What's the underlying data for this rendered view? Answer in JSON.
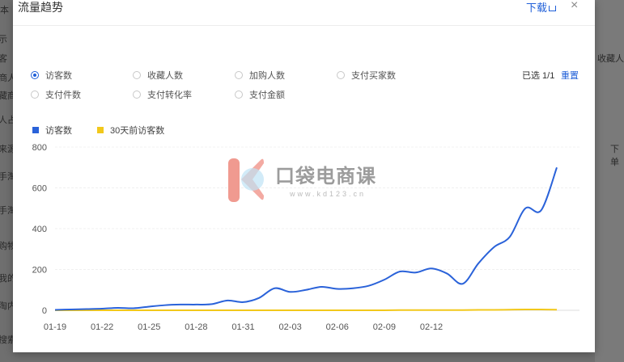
{
  "background": {
    "left_fragments": [
      "本",
      "示",
      "客",
      "商人",
      "藏商",
      "人占",
      "来源",
      "手淘",
      "手淘",
      "购物",
      "我的",
      "淘内",
      "搜索"
    ],
    "right_fragments": [
      "收藏人",
      "下单"
    ]
  },
  "modal": {
    "title": "流量趋势",
    "download_label": "下载",
    "close_symbol": "×",
    "selected_info": "已选 1/1",
    "reset_label": "重置"
  },
  "metrics": [
    {
      "label": "访客数",
      "checked": true
    },
    {
      "label": "收藏人数",
      "checked": false
    },
    {
      "label": "加购人数",
      "checked": false
    },
    {
      "label": "支付买家数",
      "checked": false
    },
    {
      "label": "支付件数",
      "checked": false
    },
    {
      "label": "支付转化率",
      "checked": false
    },
    {
      "label": "支付金额",
      "checked": false
    }
  ],
  "watermark": {
    "text": "口袋电商课",
    "url": "www.kd123.cn"
  },
  "colors": {
    "visitors": "#2a62d9",
    "visitors_30d_ago": "#f2c81b",
    "accent": "#1f5fd8"
  },
  "chart_data": {
    "type": "line",
    "title": "",
    "xlabel": "",
    "ylabel": "",
    "ylim": [
      0,
      800
    ],
    "yticks": [
      0,
      200,
      400,
      600,
      800
    ],
    "grid": true,
    "legend_position": "top-left",
    "x_tick_labels": [
      "01-19",
      "01-22",
      "01-25",
      "01-28",
      "01-31",
      "02-03",
      "02-06",
      "02-09",
      "02-12"
    ],
    "series": [
      {
        "name": "访客数",
        "color": "#2a62d9",
        "values": [
          2,
          4,
          6,
          8,
          12,
          10,
          18,
          25,
          28,
          28,
          30,
          48,
          40,
          60,
          108,
          90,
          100,
          115,
          105,
          108,
          120,
          150,
          190,
          185,
          205,
          180,
          130,
          230,
          310,
          360,
          500,
          490,
          700
        ]
      },
      {
        "name": "30天前访客数",
        "color": "#f2c81b",
        "values": [
          0,
          0,
          0,
          0,
          0,
          0,
          0,
          0,
          0,
          0,
          0,
          0,
          0,
          0,
          0,
          0,
          0,
          0,
          0,
          0,
          0,
          0,
          1,
          1,
          1,
          1,
          1,
          2,
          2,
          3,
          4,
          4,
          3
        ]
      }
    ]
  }
}
